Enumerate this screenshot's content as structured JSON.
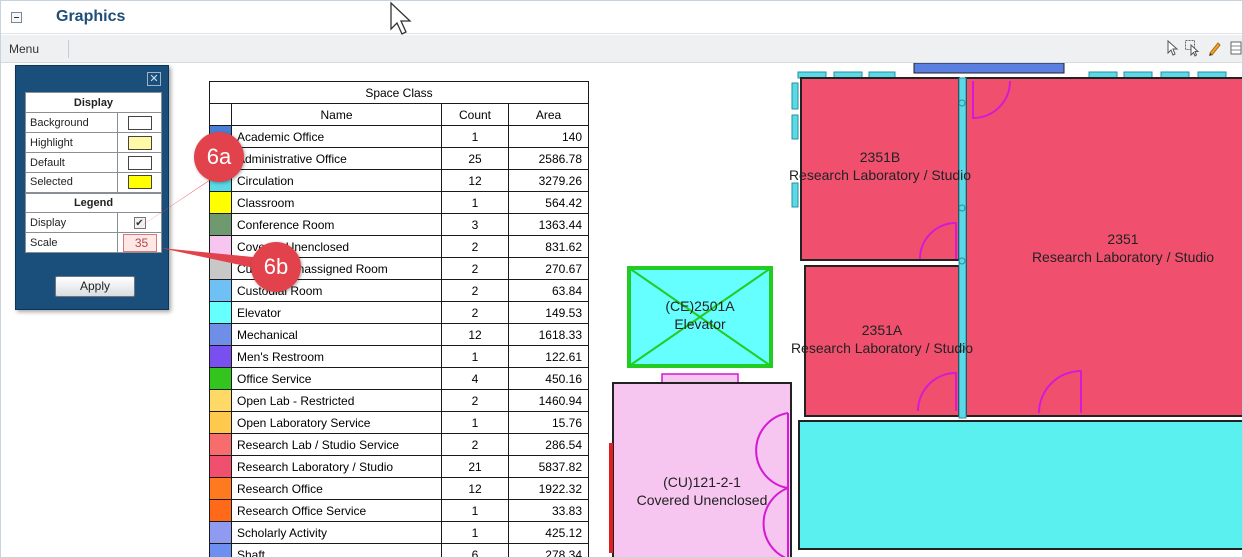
{
  "window": {
    "title": "Graphics"
  },
  "menubar": {
    "menu_label": "Menu"
  },
  "toolbar": {
    "icons": [
      "select-arrow-icon",
      "select-window-icon",
      "pencil-icon",
      "grid-icon"
    ]
  },
  "panel": {
    "display_header": "Display",
    "background_label": "Background",
    "highlight_label": "Highlight",
    "default_label": "Default",
    "selected_label": "Selected",
    "legend_header": "Legend",
    "legend_display_label": "Display",
    "legend_display_checked": true,
    "scale_label": "Scale",
    "scale_value": "35",
    "apply_label": "Apply",
    "colors": {
      "background": "#ffffff",
      "highlight": "#fff9a6",
      "default": "#ffffff",
      "selected": "#ffff00"
    }
  },
  "callouts": {
    "a": "6a",
    "b": "6b"
  },
  "legend": {
    "title": "Space Class",
    "headers": [
      "Name",
      "Count",
      "Area"
    ],
    "rows": [
      {
        "color": "#4a7fd6",
        "name": "Academic Office",
        "count": "1",
        "area": "140"
      },
      {
        "color": "#4a7fd6",
        "name": "Administrative Office",
        "count": "25",
        "area": "2586.78"
      },
      {
        "color": "#5bd9e6",
        "name": "Circulation",
        "count": "12",
        "area": "3279.26"
      },
      {
        "color": "#ffff00",
        "name": "Classroom",
        "count": "1",
        "area": "564.42"
      },
      {
        "color": "#6f9a6f",
        "name": "Conference Room",
        "count": "3",
        "area": "1363.44"
      },
      {
        "color": "#f7c6f0",
        "name": "Covered Unenclosed",
        "count": "2",
        "area": "831.62"
      },
      {
        "color": "#c8c8c8",
        "name": "Currently Unassigned Room",
        "count": "2",
        "area": "270.67"
      },
      {
        "color": "#6ec0f5",
        "name": "Custodial Room",
        "count": "2",
        "area": "63.84"
      },
      {
        "color": "#66ffff",
        "name": "Elevator",
        "count": "2",
        "area": "149.53"
      },
      {
        "color": "#6e8ee8",
        "name": "Mechanical",
        "count": "12",
        "area": "1618.33"
      },
      {
        "color": "#7a4ff0",
        "name": "Men's Restroom",
        "count": "1",
        "area": "122.61"
      },
      {
        "color": "#33c41d",
        "name": "Office Service",
        "count": "4",
        "area": "450.16"
      },
      {
        "color": "#ffd966",
        "name": "Open Lab - Restricted",
        "count": "2",
        "area": "1460.94"
      },
      {
        "color": "#ffc94d",
        "name": "Open Laboratory Service",
        "count": "1",
        "area": "15.76"
      },
      {
        "color": "#f76d6d",
        "name": "Research Lab / Studio Service",
        "count": "2",
        "area": "286.54"
      },
      {
        "color": "#f0506e",
        "name": "Research Laboratory / Studio",
        "count": "21",
        "area": "5837.82"
      },
      {
        "color": "#ff7a1f",
        "name": "Research Office",
        "count": "12",
        "area": "1922.32"
      },
      {
        "color": "#ff6a1a",
        "name": "Research Office Service",
        "count": "1",
        "area": "33.83"
      },
      {
        "color": "#8f9bf0",
        "name": "Scholarly Activity",
        "count": "1",
        "area": "425.12"
      },
      {
        "color": "#6f8ff0",
        "name": "Shaft",
        "count": "6",
        "area": "278.34"
      }
    ]
  },
  "plan": {
    "rooms": [
      {
        "id": "2351B",
        "name": "Research Laboratory / Studio",
        "color": "#f0506e"
      },
      {
        "id": "2351",
        "name": "Research Laboratory / Studio",
        "color": "#f0506e"
      },
      {
        "id": "2351A",
        "name": "Research Laboratory / Studio",
        "color": "#f0506e"
      },
      {
        "id": "(CE)2501A",
        "name": "Elevator",
        "color": "#66ffff"
      },
      {
        "id": "(CU)121-2-1",
        "name": "Covered Unenclosed",
        "color": "#f7c6f0"
      }
    ]
  }
}
